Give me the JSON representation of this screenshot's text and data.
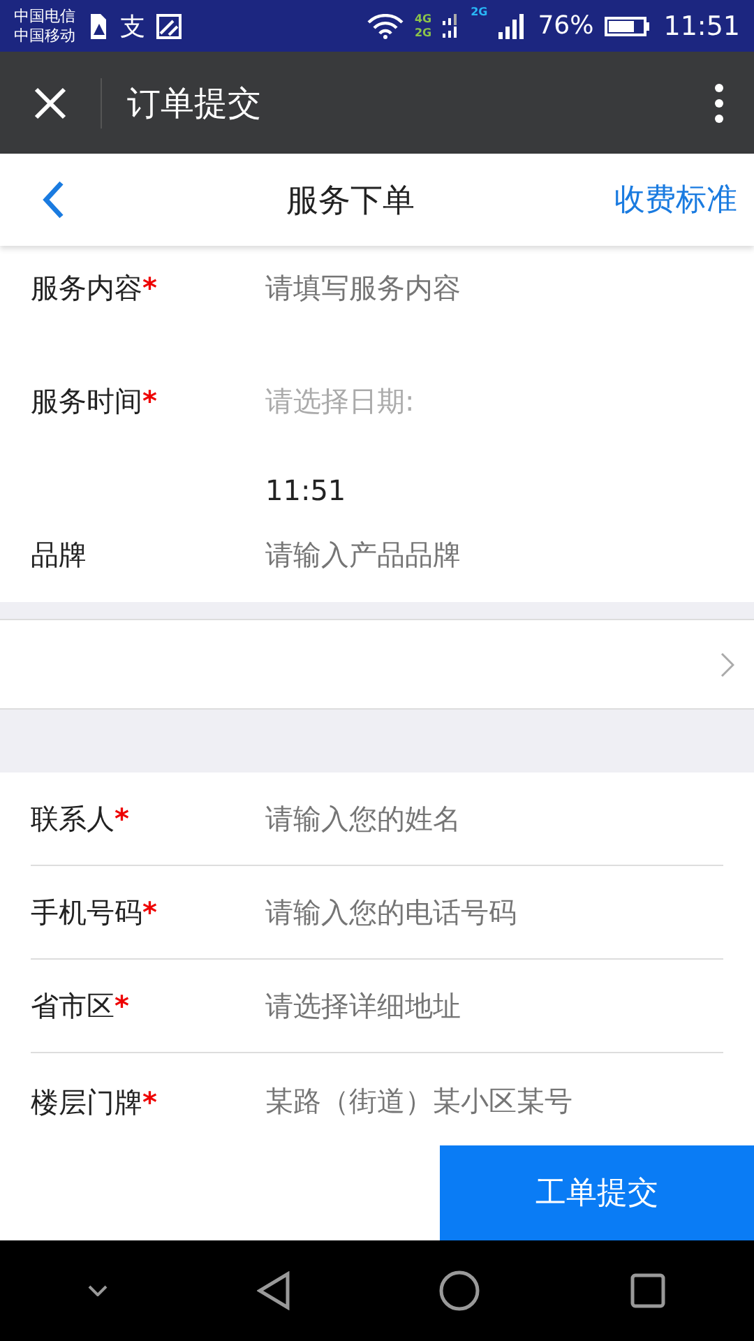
{
  "status_bar": {
    "carriers": [
      "中国电信",
      "中国移动"
    ],
    "app_glyph": "支",
    "networks": [
      {
        "label": "4G",
        "color": "#8bc34a"
      },
      {
        "label": "2G",
        "color": "#8bc34a"
      },
      {
        "label": "2G",
        "color": "#29b6f6"
      }
    ],
    "battery": "76%",
    "time": "11:51"
  },
  "app_bar": {
    "title": "订单提交"
  },
  "header": {
    "title": "服务下单",
    "action": "收费标准"
  },
  "service_fields": [
    {
      "kind": "textarea",
      "label": "服务内容",
      "required_mark": "*",
      "placeholder": "请填写服务内容"
    },
    {
      "kind": "datetime",
      "label": "服务时间",
      "required_mark": "*",
      "placeholder": "请选择日期:",
      "value": "11:51"
    },
    {
      "kind": "input",
      "label": "品牌",
      "placeholder": "请输入产品品牌"
    }
  ],
  "contact_fields": [
    {
      "label": "联系人",
      "required_mark": "*",
      "placeholder": "请输入您的姓名"
    },
    {
      "label": "手机号码",
      "required_mark": "*",
      "placeholder": "请输入您的电话号码"
    },
    {
      "label": "省市区",
      "required_mark": "*",
      "placeholder": "请选择详细地址"
    },
    {
      "label": "楼层门牌",
      "required_mark": "*",
      "placeholder": "某路（街道）某小区某号"
    }
  ],
  "submit_button": "工单提交"
}
